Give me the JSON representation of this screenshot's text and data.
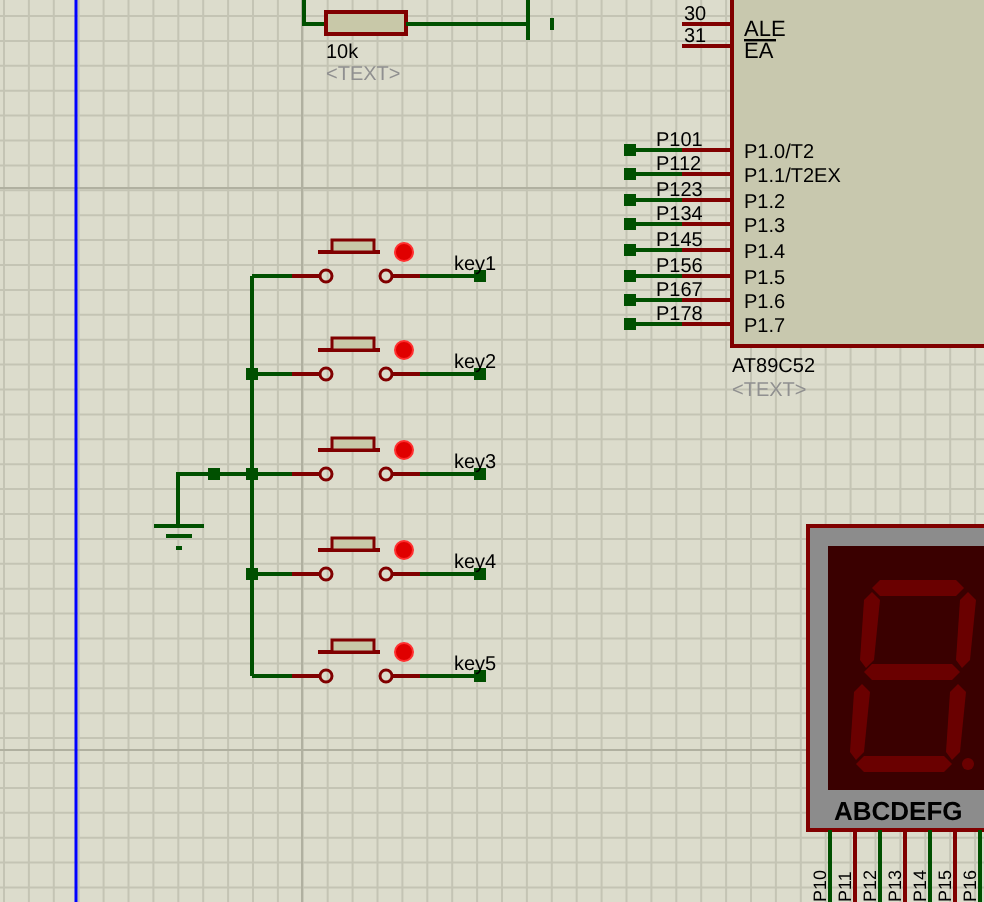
{
  "resistor": {
    "value": "10k",
    "text": "<TEXT>"
  },
  "mcu": {
    "control_pins": [
      {
        "number": "30",
        "name": "ALE",
        "overline": false
      },
      {
        "number": "31",
        "name": "EA",
        "overline": true
      }
    ],
    "port_pins": [
      {
        "net": "P101",
        "name": "P1.0/T2"
      },
      {
        "net": "P112",
        "name": "P1.1/T2EX"
      },
      {
        "net": "P123",
        "name": "P1.2"
      },
      {
        "net": "P134",
        "name": "P1.3"
      },
      {
        "net": "P145",
        "name": "P1.4"
      },
      {
        "net": "P156",
        "name": "P1.5"
      },
      {
        "net": "P167",
        "name": "P1.6"
      },
      {
        "net": "P178",
        "name": "P1.7"
      }
    ],
    "part": "AT89C52",
    "text": "<TEXT>"
  },
  "switches": [
    {
      "label": "key1"
    },
    {
      "label": "key2"
    },
    {
      "label": "key3"
    },
    {
      "label": "key4"
    },
    {
      "label": "key5"
    }
  ],
  "display": {
    "segments_label": "ABCDEFG",
    "pins": [
      "P10",
      "P11",
      "P12",
      "P13",
      "P14",
      "P15",
      "P16"
    ]
  }
}
